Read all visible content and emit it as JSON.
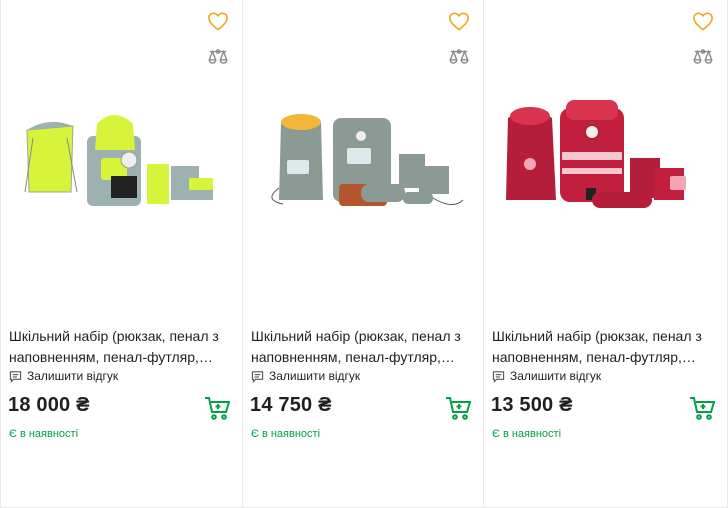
{
  "colors": {
    "accent_green": "#00a046",
    "heart_outline": "#f5a623",
    "text": "#221f1f",
    "border": "#e9e9e9"
  },
  "icons": {
    "favorite": "heart-outline-icon",
    "compare": "scales-icon",
    "review": "comment-icon",
    "cart": "cart-icon"
  },
  "products": [
    {
      "title": "Шкільний набір (рюкзак, пенал з наповненням, пенал-футляр, сумка для взуття)",
      "review_label": "Залишити відгук",
      "price": "18 000 ₴",
      "stock": "Є в наявності"
    },
    {
      "title": "Шкільний набір (рюкзак, пенал з наповненням, пенал-футляр, сумка для взуття)",
      "review_label": "Залишити відгук",
      "price": "14 750 ₴",
      "stock": "Є в наявності"
    },
    {
      "title": "Шкільний набір (рюкзак, пенал з наповненням, пенал-футляр, сумка для взуття)",
      "review_label": "Залишити відгук",
      "price": "13 500 ₴",
      "stock": "Є в наявності"
    }
  ]
}
